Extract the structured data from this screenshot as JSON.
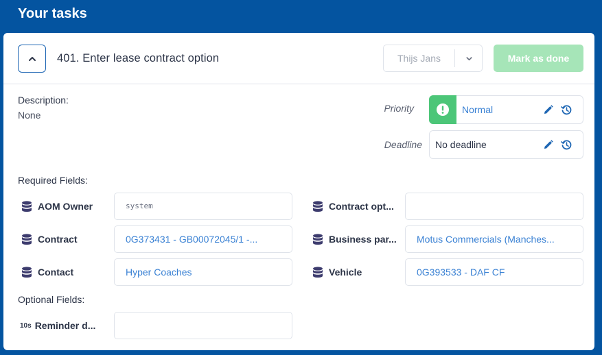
{
  "page": {
    "title": "Your tasks"
  },
  "task": {
    "title": "401. Enter lease contract option",
    "assignee": "Thijs Jans",
    "mark_done_label": "Mark as done",
    "description_label": "Description:",
    "description_value": "None",
    "priority_label": "Priority",
    "priority_value": "Normal",
    "deadline_label": "Deadline",
    "deadline_value": "No deadline"
  },
  "sections": {
    "required": "Required Fields:",
    "optional": "Optional Fields:"
  },
  "required_fields": [
    {
      "label": "AOM Owner",
      "value": "system"
    },
    {
      "label": "Contract opt...",
      "value": ""
    },
    {
      "label": "Contract",
      "value": "0G373431 - GB00072045/1 -..."
    },
    {
      "label": "Business par...",
      "value": "Motus Commercials (Manches..."
    },
    {
      "label": "Contact",
      "value": "Hyper Coaches"
    },
    {
      "label": "Vehicle",
      "value": "0G393533 - DAF CF"
    }
  ],
  "optional_fields": [
    {
      "icon_text": "10s",
      "label": "Reminder d...",
      "value": ""
    }
  ],
  "icons": {
    "collapse": "chevron-up-icon",
    "assignee_toggle": "chevron-down-icon",
    "priority": "exclamation-circle-icon",
    "edit": "pencil-icon",
    "history": "history-icon",
    "field": "database-icon"
  },
  "colors": {
    "header_bg": "#0454a0",
    "accent": "#1f67b4",
    "link": "#3b82d4",
    "priority_normal": "#4cc678",
    "done_button": "#a6e5b8"
  }
}
